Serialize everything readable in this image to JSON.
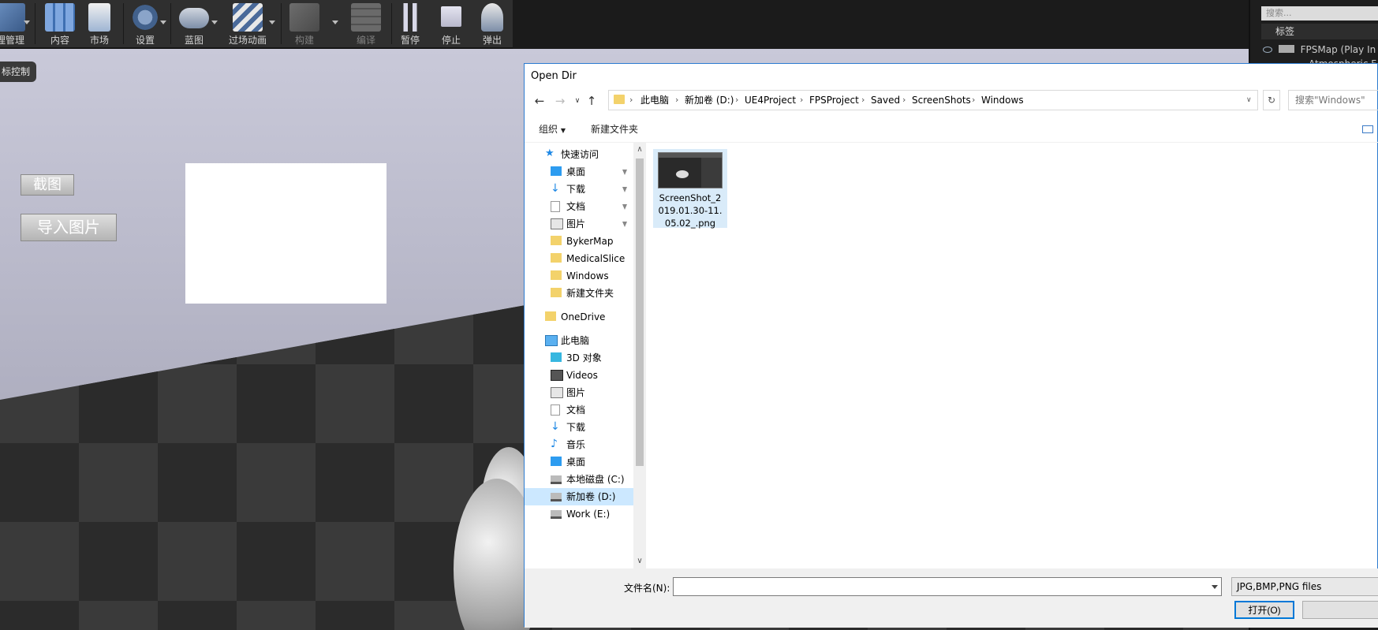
{
  "toolbar": {
    "buttons": [
      {
        "label": "理管理"
      },
      {
        "label": "内容"
      },
      {
        "label": "市场"
      },
      {
        "label": "设置"
      },
      {
        "label": "蓝图"
      },
      {
        "label": "过场动画"
      },
      {
        "label": "构建"
      },
      {
        "label": "编译"
      },
      {
        "label": "暂停"
      },
      {
        "label": "停止"
      },
      {
        "label": "弹出"
      }
    ]
  },
  "viewport": {
    "control_tag": "标控制",
    "screenshot_button": "截图",
    "import_button": "导入图片"
  },
  "right_panel": {
    "search_placeholder": "搜索...",
    "header": "标签",
    "rows": [
      "FPSMap (Play In",
      "Atmospheric F"
    ]
  },
  "dialog": {
    "title": "Open Dir",
    "path": [
      "此电脑",
      "新加卷 (D:)",
      "UE4Project",
      "FPSProject",
      "Saved",
      "ScreenShots",
      "Windows"
    ],
    "search_placeholder": "搜索\"Windows\"",
    "commands": {
      "organize": "组织",
      "new_folder": "新建文件夹"
    },
    "quick_access": "快速访问",
    "pinned": [
      "桌面",
      "下载",
      "文档",
      "图片"
    ],
    "folders": [
      "BykerMap",
      "MedicalSlice",
      "Windows",
      "新建文件夹"
    ],
    "onedrive": "OneDrive",
    "this_pc": "此电脑",
    "pc_items": [
      "3D 对象",
      "Videos",
      "图片",
      "文档",
      "下载",
      "音乐",
      "桌面",
      "本地磁盘 (C:)",
      "新加卷 (D:)",
      "Work (E:)"
    ],
    "selected_pc_item": "新加卷 (D:)",
    "file": {
      "name": "ScreenShot_2019.01.30-11.05.02_.png"
    },
    "filename_label": "文件名(N):",
    "filename_value": "",
    "file_type": "JPG,BMP,PNG files",
    "open_button": "打开(O)"
  }
}
